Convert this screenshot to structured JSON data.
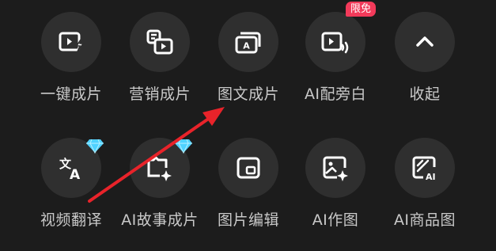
{
  "colors": {
    "background": "#1c1c1c",
    "button_bg": "#2f2f2f",
    "label": "#c9c9c9",
    "badge": "#f23a5a",
    "gem": "#4fd2ff",
    "annotation_arrow": "#e8232a"
  },
  "row1": [
    {
      "label": "一键成片",
      "icon": "one-click-video-icon"
    },
    {
      "label": "营销成片",
      "icon": "marketing-video-icon"
    },
    {
      "label": "图文成片",
      "icon": "image-text-video-icon"
    },
    {
      "label": "AI配旁白",
      "icon": "ai-voiceover-icon",
      "badge": "限免"
    },
    {
      "label": "收起",
      "icon": "chevron-up-icon"
    }
  ],
  "row2": [
    {
      "label": "视频翻译",
      "icon": "translate-icon",
      "premium": "diamond-icon"
    },
    {
      "label": "AI故事成片",
      "icon": "ai-story-icon",
      "premium": "diamond-icon"
    },
    {
      "label": "图片编辑",
      "icon": "image-edit-icon"
    },
    {
      "label": "AI作图",
      "icon": "ai-draw-icon"
    },
    {
      "label": "AI商品图",
      "icon": "ai-product-image-icon"
    }
  ]
}
